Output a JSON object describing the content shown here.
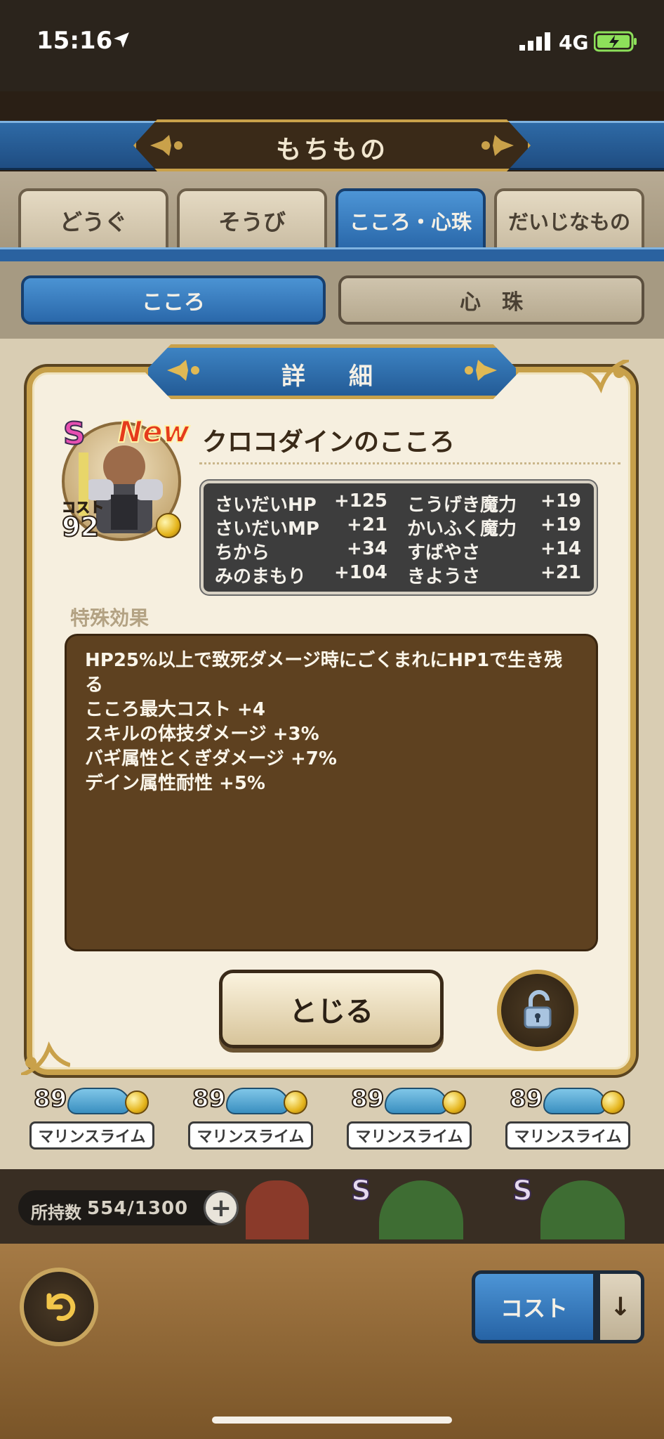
{
  "status_bar": {
    "time": "15:16",
    "network": "4G"
  },
  "header": {
    "title": "もちもの"
  },
  "tabs": [
    {
      "label": "どうぐ",
      "active": false
    },
    {
      "label": "そうび",
      "active": false
    },
    {
      "label": "こころ・心珠",
      "active": true
    },
    {
      "label": "だいじなもの",
      "active": false
    }
  ],
  "subtabs": [
    {
      "label": "こころ",
      "active": true
    },
    {
      "label": "心　珠",
      "active": false
    }
  ],
  "grid_row": [
    {
      "level": "89",
      "name": "マリンスライム"
    },
    {
      "level": "89",
      "name": "マリンスライム"
    },
    {
      "level": "89",
      "name": "マリンスライム"
    },
    {
      "level": "89",
      "name": "マリンスライム"
    }
  ],
  "grid_row_rank": "S",
  "inventory": {
    "label": "所持数",
    "count": "554/1300",
    "plus": "+"
  },
  "footer": {
    "cost_button": "コスト",
    "sort_arrow": "↓"
  },
  "dialog": {
    "title": "詳　細",
    "rank": "S",
    "new_badge": "New",
    "cost_label": "コスト",
    "cost_value": "92",
    "name": "クロコダインのこころ",
    "stats": [
      {
        "label": "さいだいHP",
        "value": "+125"
      },
      {
        "label": "さいだいMP",
        "value": "+21"
      },
      {
        "label": "ちから",
        "value": "+34"
      },
      {
        "label": "みのまもり",
        "value": "+104"
      },
      {
        "label": "こうげき魔力",
        "value": "+19"
      },
      {
        "label": "かいふく魔力",
        "value": "+19"
      },
      {
        "label": "すばやさ",
        "value": "+14"
      },
      {
        "label": "きようさ",
        "value": "+21"
      }
    ],
    "effect_header": "特殊効果",
    "effects": [
      "HP25%以上で致死ダメージ時にごくまれにHP1で生き残",
      "る",
      "こころ最大コスト +4",
      "スキルの体技ダメージ +3%",
      "バギ属性とくぎダメージ +7%",
      "デイン属性耐性 +5%"
    ],
    "close_button": "とじる",
    "lock_icon": "unlocked-padlock-icon"
  }
}
